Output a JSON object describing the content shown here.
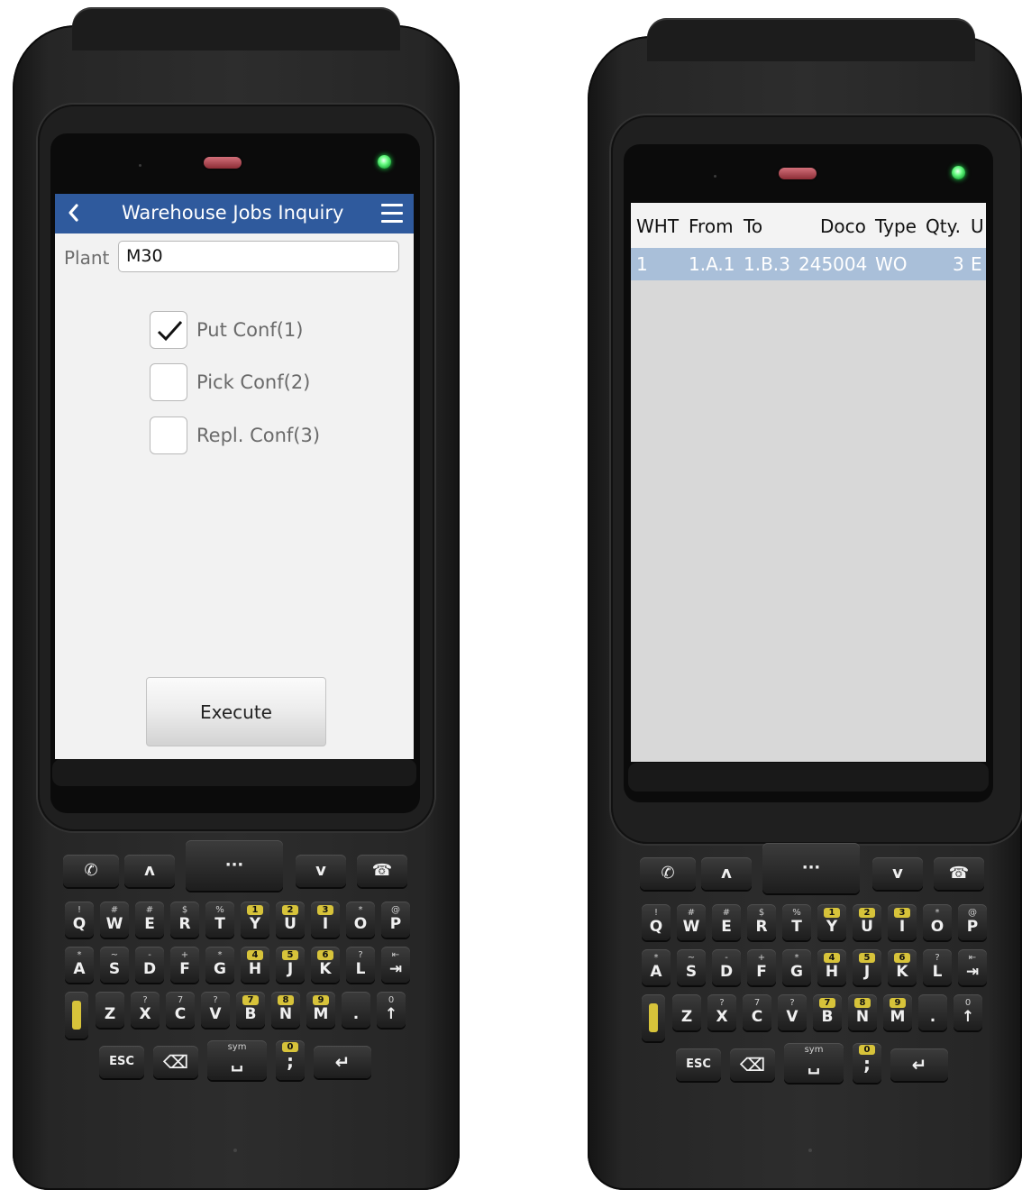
{
  "left_screen": {
    "app_title": "Warehouse Jobs Inquiry",
    "back_icon": "chevron-left-icon",
    "menu_icon": "hamburger-menu-icon",
    "plant_label": "Plant",
    "plant_value": "M30",
    "checkboxes": [
      {
        "label": "Put Conf(1)",
        "checked": true
      },
      {
        "label": "Pick Conf(2)",
        "checked": false
      },
      {
        "label": "Repl. Conf(3)",
        "checked": false
      }
    ],
    "execute_label": "Execute"
  },
  "right_screen": {
    "columns": [
      "WHT",
      "From",
      "To",
      "Doco",
      "Type",
      "Qty.",
      "U"
    ],
    "rows": [
      {
        "wht": "1",
        "from": "1.A.1",
        "to": "1.B.3",
        "doco": "245004",
        "type": "WO",
        "qty": "3",
        "uom": "E"
      }
    ]
  },
  "keypad": {
    "nav_keys": [
      "call-icon",
      "left-up-icon",
      "center-key",
      "right-down-icon",
      "end-call-icon"
    ],
    "row1": [
      {
        "sub": "!",
        "main": "Q"
      },
      {
        "sub": "#",
        "main": "W"
      },
      {
        "sub": "#",
        "main": "E"
      },
      {
        "sub": "$",
        "main": "R"
      },
      {
        "sub": "%",
        "main": "T"
      },
      {
        "sub": "1",
        "main": "Y",
        "yellow": true
      },
      {
        "sub": "2",
        "main": "U",
        "yellow": true
      },
      {
        "sub": "3",
        "main": "I",
        "yellow": true
      },
      {
        "sub": "*",
        "main": "O"
      },
      {
        "sub": "@",
        "main": "P"
      }
    ],
    "row2": [
      {
        "sub": "*",
        "main": "A"
      },
      {
        "sub": "~",
        "main": "S"
      },
      {
        "sub": "-",
        "main": "D"
      },
      {
        "sub": "+",
        "main": "F"
      },
      {
        "sub": "*",
        "main": "G"
      },
      {
        "sub": "4",
        "main": "H",
        "yellow": true
      },
      {
        "sub": "5",
        "main": "J",
        "yellow": true
      },
      {
        "sub": "6",
        "main": "K",
        "yellow": true
      },
      {
        "sub": "?",
        "main": "L"
      },
      {
        "sub": "⇤",
        "main": "⇥"
      }
    ],
    "row3": [
      {
        "sub": "",
        "main": "Z"
      },
      {
        "sub": "?",
        "main": "X"
      },
      {
        "sub": "7",
        "main": "C"
      },
      {
        "sub": "?",
        "main": "V"
      },
      {
        "sub": "7",
        "main": "B",
        "yellow": true
      },
      {
        "sub": "8",
        "main": "N",
        "yellow": true
      },
      {
        "sub": "9",
        "main": "M",
        "yellow": true
      },
      {
        "sub": "",
        "main": "."
      },
      {
        "sub": "0",
        "main": "↑"
      }
    ],
    "row4": [
      {
        "sub": "",
        "main": "ESC"
      },
      {
        "sub": "",
        "main": "⌫"
      },
      {
        "sub": "sym",
        "main": "␣"
      },
      {
        "sub": "0",
        "main": ";",
        "yellow": true
      },
      {
        "sub": "",
        "main": "↵"
      }
    ]
  },
  "colors": {
    "appbar": "#2f5a9d",
    "selected_row": "#a9bfd9",
    "led": "#3cff5c",
    "yellow_key": "#d7c33a"
  }
}
